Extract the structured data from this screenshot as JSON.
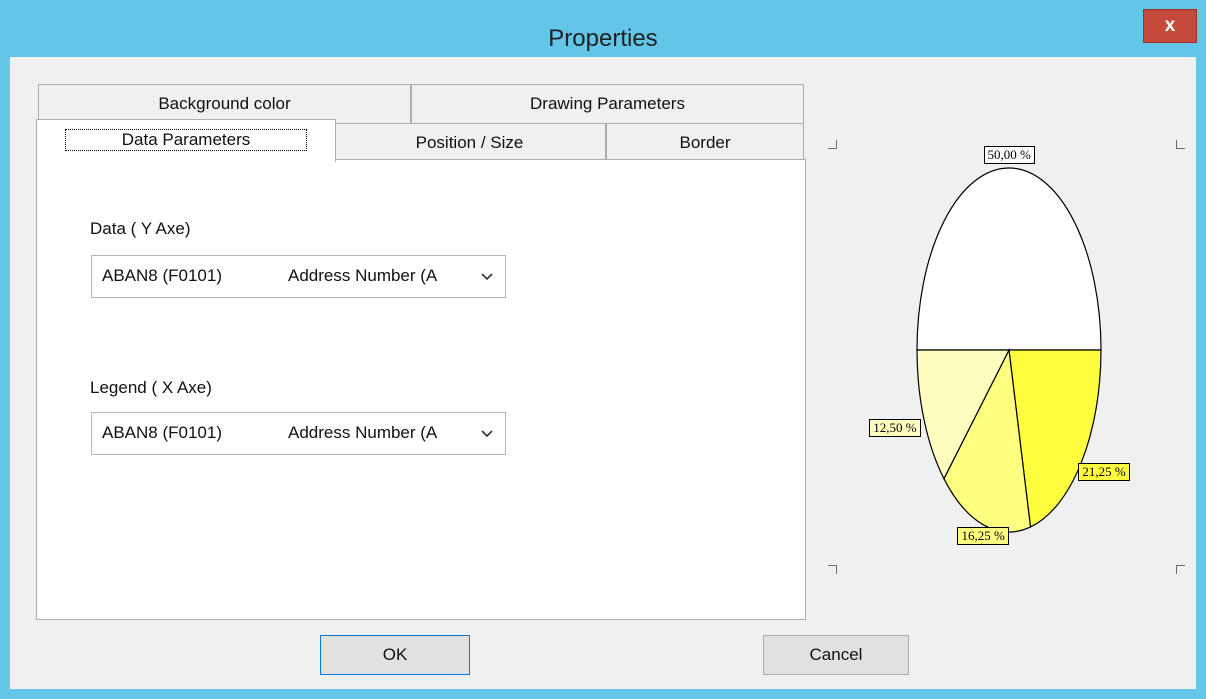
{
  "window": {
    "title": "Properties",
    "close_glyph": "x"
  },
  "tabs": {
    "row_back": [
      "Background color",
      "Drawing Parameters"
    ],
    "row_front": [
      "Data Parameters",
      "Position / Size",
      "Border"
    ],
    "active": "Data Parameters"
  },
  "data_y": {
    "label": "Data ( Y Axe)",
    "code": "ABAN8 (F0101)",
    "description": "Address Number (A"
  },
  "legend_x": {
    "label": "Legend  ( X Axe)",
    "code": "ABAN8 (F0101)",
    "description": "Address Number (A"
  },
  "buttons": {
    "ok": "OK",
    "cancel": "Cancel"
  },
  "chart_data": {
    "type": "pie",
    "categories": [
      "",
      "",
      "",
      ""
    ],
    "values": [
      50.0,
      21.25,
      16.25,
      12.5
    ],
    "data_labels": [
      "50,00 %",
      "21,25 %",
      "16,25 %",
      "12,50 %"
    ],
    "colors": [
      "#ffffff",
      "#ffff40",
      "#ffff80",
      "#ffffc0"
    ]
  },
  "colors": {
    "title_bar": "#63c5e8",
    "close_button": "#c64a3c",
    "dialog_bg": "#f0f0f0",
    "focus_border": "#0078d7"
  }
}
